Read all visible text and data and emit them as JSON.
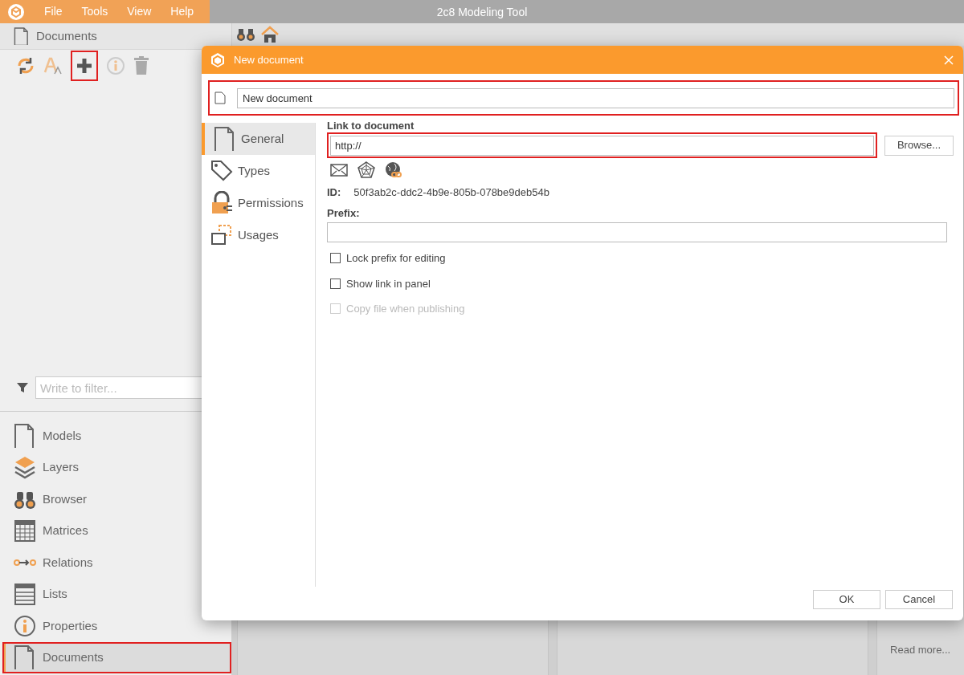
{
  "app": {
    "title": "2c8 Modeling Tool",
    "menu": [
      "File",
      "Tools",
      "View",
      "Help"
    ]
  },
  "left_panel": {
    "title": "Documents",
    "filter_placeholder": "Write to filter..."
  },
  "nav": [
    {
      "label": "Models",
      "kind": "models",
      "selected": false
    },
    {
      "label": "Layers",
      "kind": "layers",
      "selected": false
    },
    {
      "label": "Browser",
      "kind": "browser",
      "selected": false
    },
    {
      "label": "Matrices",
      "kind": "matrices",
      "selected": false
    },
    {
      "label": "Relations",
      "kind": "relations",
      "selected": false
    },
    {
      "label": "Lists",
      "kind": "lists",
      "selected": false
    },
    {
      "label": "Properties",
      "kind": "properties",
      "selected": false
    },
    {
      "label": "Documents",
      "kind": "documents",
      "selected": true
    }
  ],
  "content": {
    "read_more": "Read more..."
  },
  "dialog": {
    "title": "New document",
    "name_value": "New document",
    "tabs": [
      {
        "label": "General",
        "kind": "general",
        "selected": true
      },
      {
        "label": "Types",
        "kind": "types",
        "selected": false
      },
      {
        "label": "Permissions",
        "kind": "permissions",
        "selected": false
      },
      {
        "label": "Usages",
        "kind": "usages",
        "selected": false
      }
    ],
    "link_label": "Link to document",
    "link_value": "http://",
    "browse": "Browse...",
    "id_label": "ID:",
    "id_value": "50f3ab2c-ddc2-4b9e-805b-078be9deb54b",
    "prefix_label": "Prefix:",
    "checkboxes": [
      {
        "label": "Lock prefix for editing",
        "checked": false,
        "disabled": false
      },
      {
        "label": "Show link in panel",
        "checked": false,
        "disabled": false
      },
      {
        "label": "Copy file when publishing",
        "checked": false,
        "disabled": true
      }
    ],
    "buttons": [
      "OK",
      "Cancel"
    ]
  }
}
